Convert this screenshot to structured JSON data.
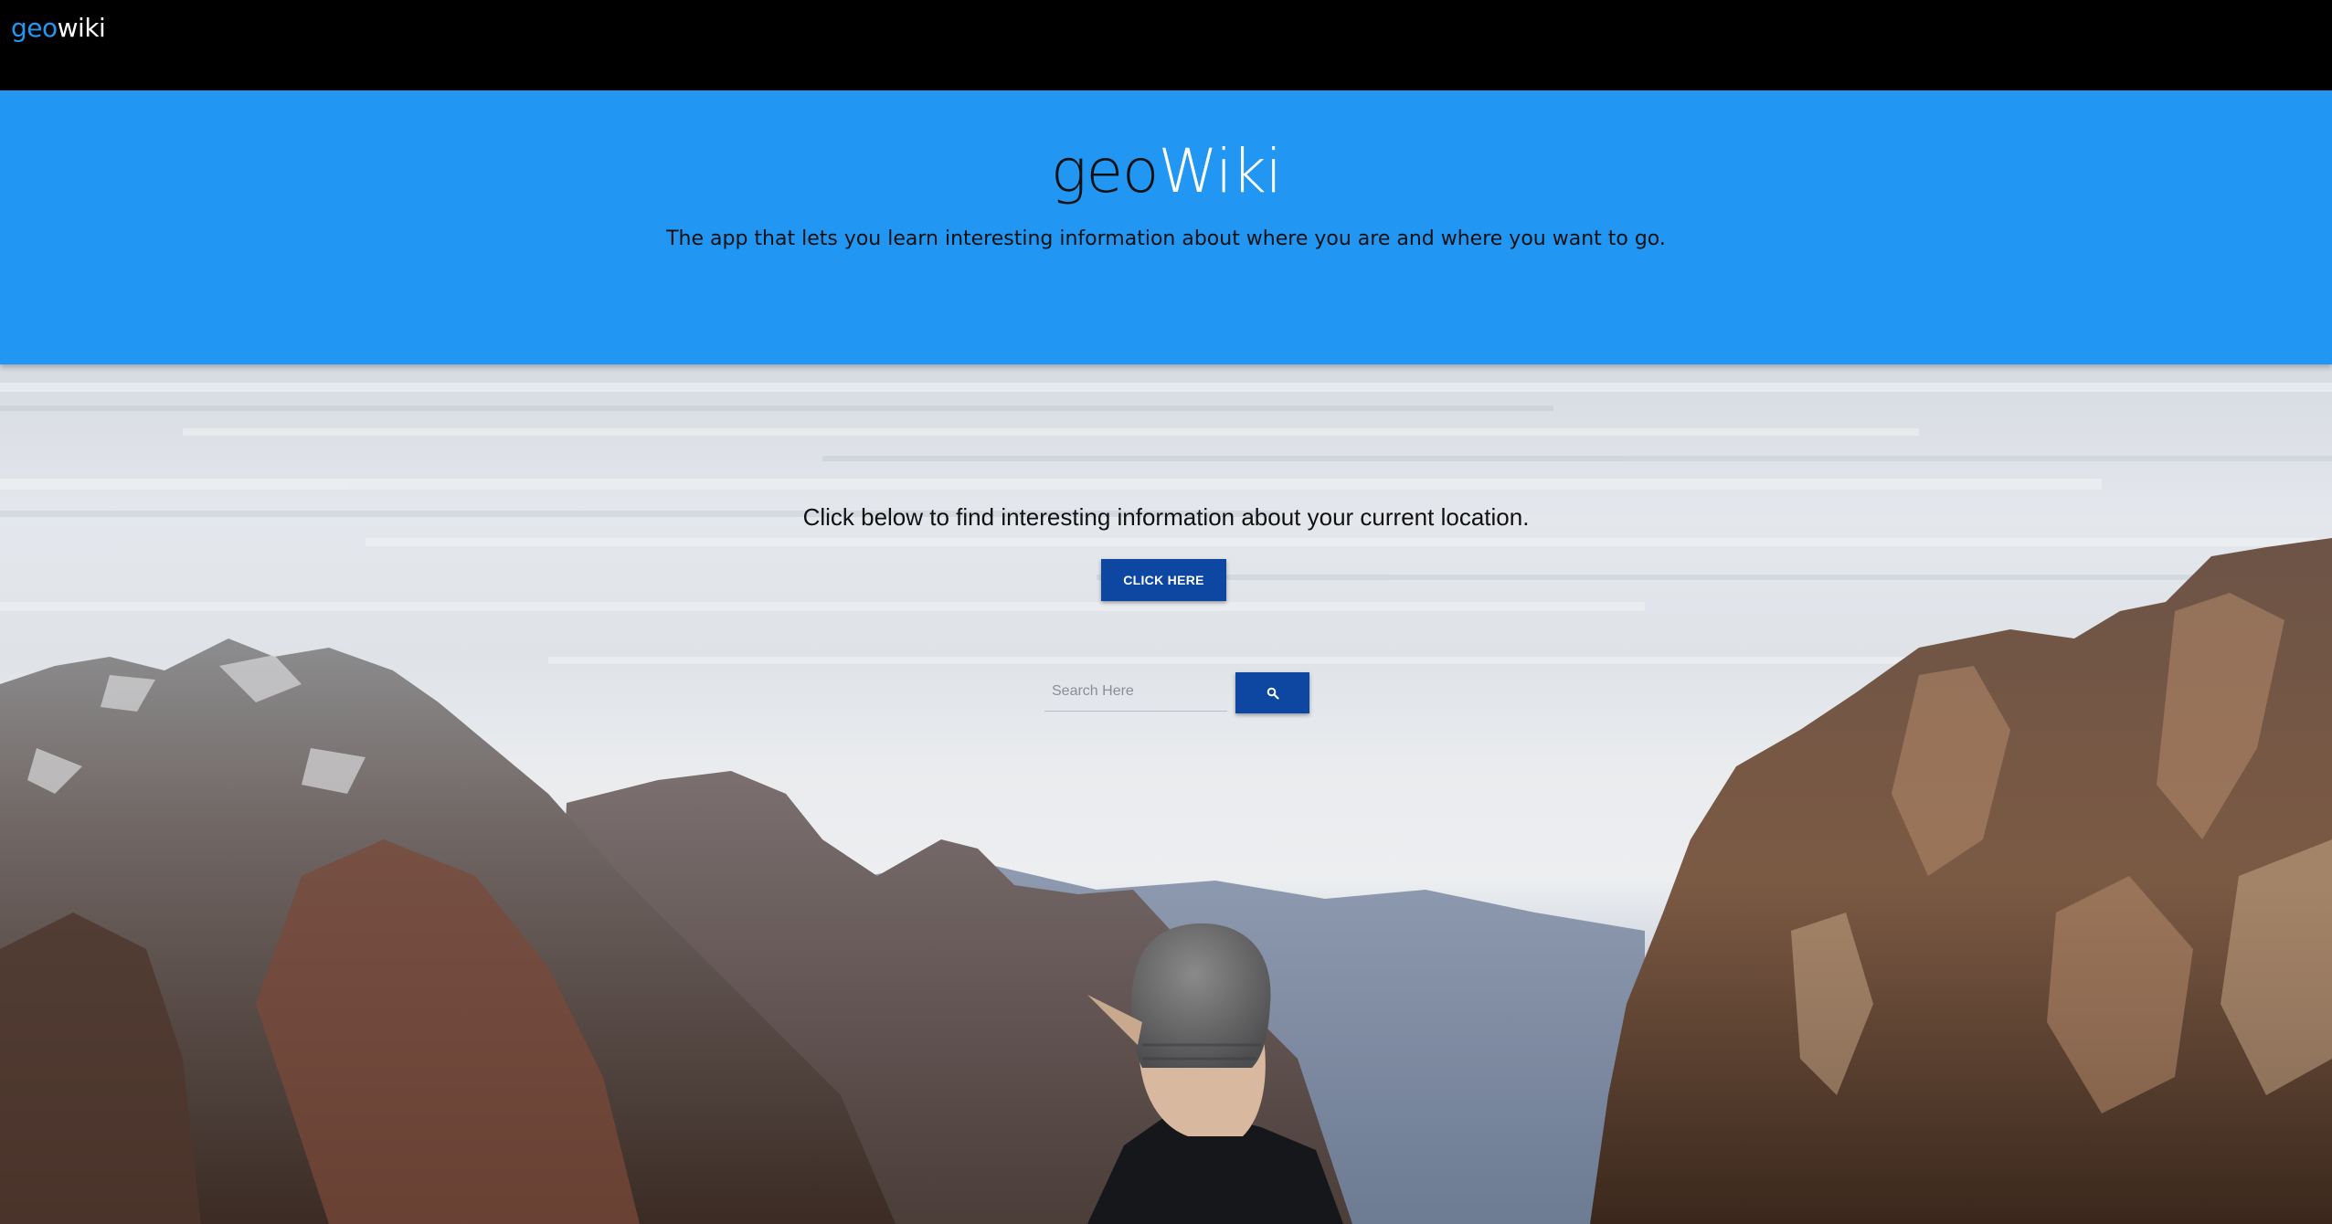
{
  "navbar": {
    "brand_geo": "geo",
    "brand_wiki": "wiki"
  },
  "hero": {
    "title_geo": "geo",
    "title_wiki": "Wiki",
    "tagline": "The app that lets you learn interesting information about where you are and where you want to go."
  },
  "locate": {
    "prompt": "Click below to find interesting information about your current location.",
    "button_label": "CLICK HERE"
  },
  "search": {
    "placeholder": "Search Here",
    "value": "",
    "button_icon": "search-icon"
  },
  "colors": {
    "navbar_bg": "#000000",
    "hero_bg": "#2196f3",
    "brand_accent": "#2196f3",
    "button_bg": "#0d47a1"
  }
}
